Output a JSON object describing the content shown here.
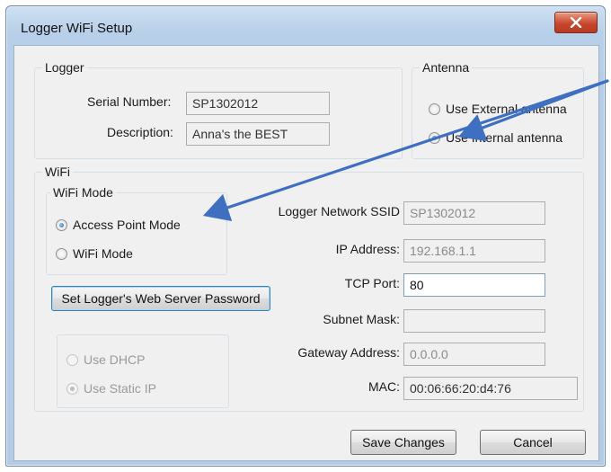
{
  "window": {
    "title": "Logger WiFi Setup",
    "close_icon": "close-x-icon"
  },
  "logger": {
    "legend": "Logger",
    "serial_label": "Serial Number:",
    "serial_value": "SP1302012",
    "description_label": "Description:",
    "description_value": "Anna's the BEST"
  },
  "antenna": {
    "legend": "Antenna",
    "options": [
      {
        "label": "Use External antenna",
        "selected": false
      },
      {
        "label": "Use Internal antenna",
        "selected": true
      }
    ]
  },
  "wifi": {
    "legend": "WiFi",
    "mode": {
      "legend": "WiFi Mode",
      "options": [
        {
          "label": "Access Point Mode",
          "selected": true
        },
        {
          "label": "WiFi Mode",
          "selected": false
        }
      ]
    },
    "password_button": "Set Logger's Web Server Password",
    "ip_mode": {
      "options": [
        {
          "label": "Use DHCP",
          "selected": false
        },
        {
          "label": "Use Static IP",
          "selected": true
        }
      ]
    },
    "fields": {
      "ssid_label": "Logger Network SSID",
      "ssid_value": "SP1302012",
      "ip_label": "IP Address:",
      "ip_value": "192.168.1.1",
      "port_label": "TCP Port:",
      "port_value": "80",
      "subnet_label": "Subnet Mask:",
      "subnet_value": "",
      "gateway_label": "Gateway Address:",
      "gateway_value": "0.0.0.0",
      "mac_label": "MAC:",
      "mac_value": "00:06:66:20:d4:76"
    }
  },
  "buttons": {
    "save": "Save Changes",
    "cancel": "Cancel"
  },
  "annotation": {
    "arrow_color": "#3f6fc1"
  }
}
